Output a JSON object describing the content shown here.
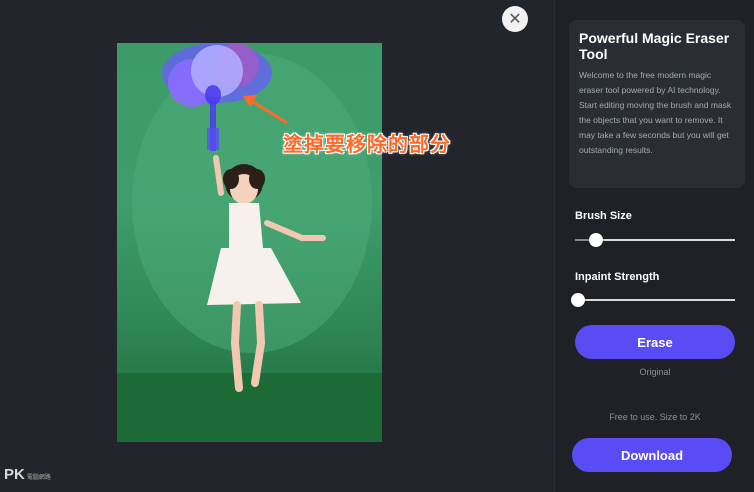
{
  "editor": {
    "annotation": "塗掉要移除的部分",
    "close_icon": "close-icon",
    "watermark": "PK",
    "watermark_sub": "電腦網路"
  },
  "panel": {
    "title": "Powerful Magic Eraser Tool",
    "description": "Welcome to the free modern magic eraser tool powered by AI technology. Start editing moving the brush and mask the objects that you want to remove. It may take a few seconds but you will get outstanding results.",
    "brush_size_label": "Brush Size",
    "brush_size_value": 0.13,
    "inpaint_label": "Inpaint Strength",
    "inpaint_value": 0.02,
    "erase_label": "Erase",
    "original_label": "Original",
    "free_note": "Free to use. Size to 2K",
    "download_label": "Download"
  },
  "colors": {
    "accent": "#5a4cf5",
    "annotation": "#ff6a2b",
    "mask": "#6a5cff"
  }
}
